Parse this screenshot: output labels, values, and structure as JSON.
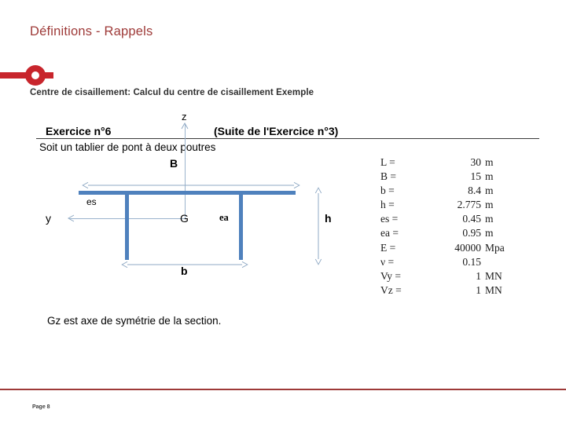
{
  "slide": {
    "title": "Définitions - Rappels",
    "subtitle": "Centre de cisaillement: Calcul du centre de cisaillement Exemple",
    "accent_color": "#9e3a38",
    "bullet_color": "#c8252c",
    "steel_color": "#4f81bd",
    "axis_color": "#9ab3cd"
  },
  "figure": {
    "exercise_title_left": "Exercice n°6",
    "exercise_title_right": "(Suite de l'Exercice n°3)",
    "intro_line": "Soit un tablier de pont à deux poutres",
    "symmetry_line": "Gz est axe de symétrie de la section.",
    "labels": {
      "z_axis": "z",
      "y_axis": "y",
      "centroid": "G",
      "flange_width": "B",
      "slab_thickness": "es",
      "web_thickness": "ea",
      "height": "h",
      "spacing": "b"
    }
  },
  "values": {
    "columns": [
      "symbol",
      "value",
      "unit"
    ],
    "rows": [
      {
        "symbol": "L =",
        "value": "30",
        "unit": "m"
      },
      {
        "symbol": "B =",
        "value": "15",
        "unit": "m"
      },
      {
        "symbol": "b =",
        "value": "8.4",
        "unit": "m"
      },
      {
        "symbol": "h =",
        "value": "2.775",
        "unit": "m"
      },
      {
        "symbol": "es =",
        "value": "0.45",
        "unit": "m"
      },
      {
        "symbol": "ea =",
        "value": "0.95",
        "unit": "m"
      },
      {
        "symbol": "E =",
        "value": "40000",
        "unit": "Mpa"
      },
      {
        "symbol": "ν =",
        "value": "0.15",
        "unit": ""
      },
      {
        "symbol": "Vy =",
        "value": "1",
        "unit": "MN"
      },
      {
        "symbol": "Vz =",
        "value": "1",
        "unit": "MN"
      }
    ]
  },
  "footer": {
    "page_label": "Page 8"
  }
}
